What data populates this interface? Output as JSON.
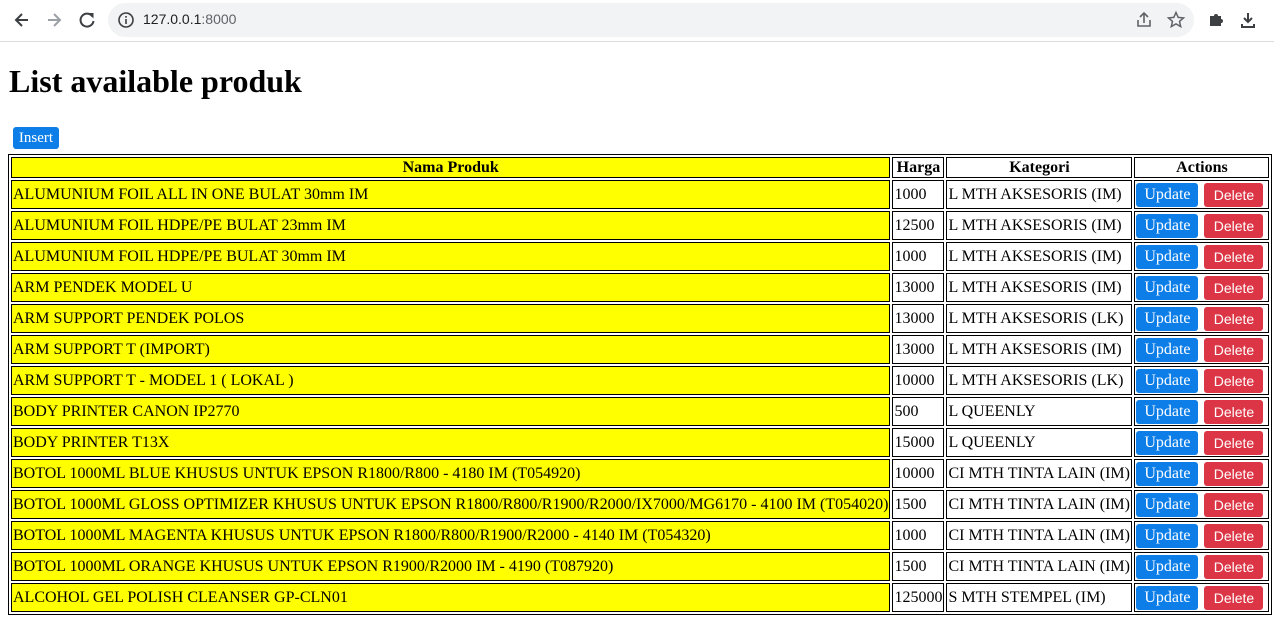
{
  "browser": {
    "url_host": "127.0.0.1",
    "url_port": ":8000"
  },
  "page": {
    "title": "List available produk",
    "insert_label": "Insert"
  },
  "table": {
    "headers": [
      "Nama Produk",
      "Harga",
      "Kategori",
      "Actions"
    ],
    "update_label": "Update",
    "delete_label": "Delete",
    "rows": [
      {
        "nama": "ALUMUNIUM FOIL ALL IN ONE BULAT 30mm IM",
        "harga": "1000",
        "kategori": "L MTH AKSESORIS (IM)"
      },
      {
        "nama": "ALUMUNIUM FOIL HDPE/PE BULAT 23mm IM",
        "harga": "12500",
        "kategori": "L MTH AKSESORIS (IM)"
      },
      {
        "nama": "ALUMUNIUM FOIL HDPE/PE BULAT 30mm IM",
        "harga": "1000",
        "kategori": "L MTH AKSESORIS (IM)"
      },
      {
        "nama": "ARM PENDEK MODEL U",
        "harga": "13000",
        "kategori": "L MTH AKSESORIS (IM)"
      },
      {
        "nama": "ARM SUPPORT PENDEK POLOS",
        "harga": "13000",
        "kategori": "L MTH AKSESORIS (LK)"
      },
      {
        "nama": "ARM SUPPORT T (IMPORT)",
        "harga": "13000",
        "kategori": "L MTH AKSESORIS (IM)"
      },
      {
        "nama": "ARM SUPPORT T - MODEL 1 ( LOKAL )",
        "harga": "10000",
        "kategori": "L MTH AKSESORIS (LK)"
      },
      {
        "nama": "BODY PRINTER CANON IP2770",
        "harga": "500",
        "kategori": "L QUEENLY"
      },
      {
        "nama": "BODY PRINTER T13X",
        "harga": "15000",
        "kategori": "L QUEENLY"
      },
      {
        "nama": "BOTOL 1000ML BLUE KHUSUS UNTUK EPSON R1800/R800 - 4180 IM (T054920)",
        "harga": "10000",
        "kategori": "CI MTH TINTA LAIN (IM)"
      },
      {
        "nama": "BOTOL 1000ML GLOSS OPTIMIZER KHUSUS UNTUK EPSON R1800/R800/R1900/R2000/IX7000/MG6170 - 4100 IM (T054020)",
        "harga": "1500",
        "kategori": "CI MTH TINTA LAIN (IM)"
      },
      {
        "nama": "BOTOL 1000ML MAGENTA KHUSUS UNTUK EPSON R1800/R800/R1900/R2000 - 4140 IM (T054320)",
        "harga": "1000",
        "kategori": "CI MTH TINTA LAIN (IM)"
      },
      {
        "nama": "BOTOL 1000ML ORANGE KHUSUS UNTUK EPSON R1900/R2000 IM - 4190 (T087920)",
        "harga": "1500",
        "kategori": "CI MTH TINTA LAIN (IM)"
      },
      {
        "nama": "ALCOHOL GEL POLISH CLEANSER GP-CLN01",
        "harga": "125000",
        "kategori": "S MTH STEMPEL (IM)"
      }
    ]
  },
  "colors": {
    "highlight": "#ffff00",
    "update_button": "#0d7ee8",
    "delete_button": "#dc3545"
  },
  "icons": [
    "back-arrow-icon",
    "forward-arrow-icon",
    "reload-icon",
    "info-icon",
    "share-icon",
    "star-icon",
    "extensions-icon",
    "download-icon"
  ]
}
